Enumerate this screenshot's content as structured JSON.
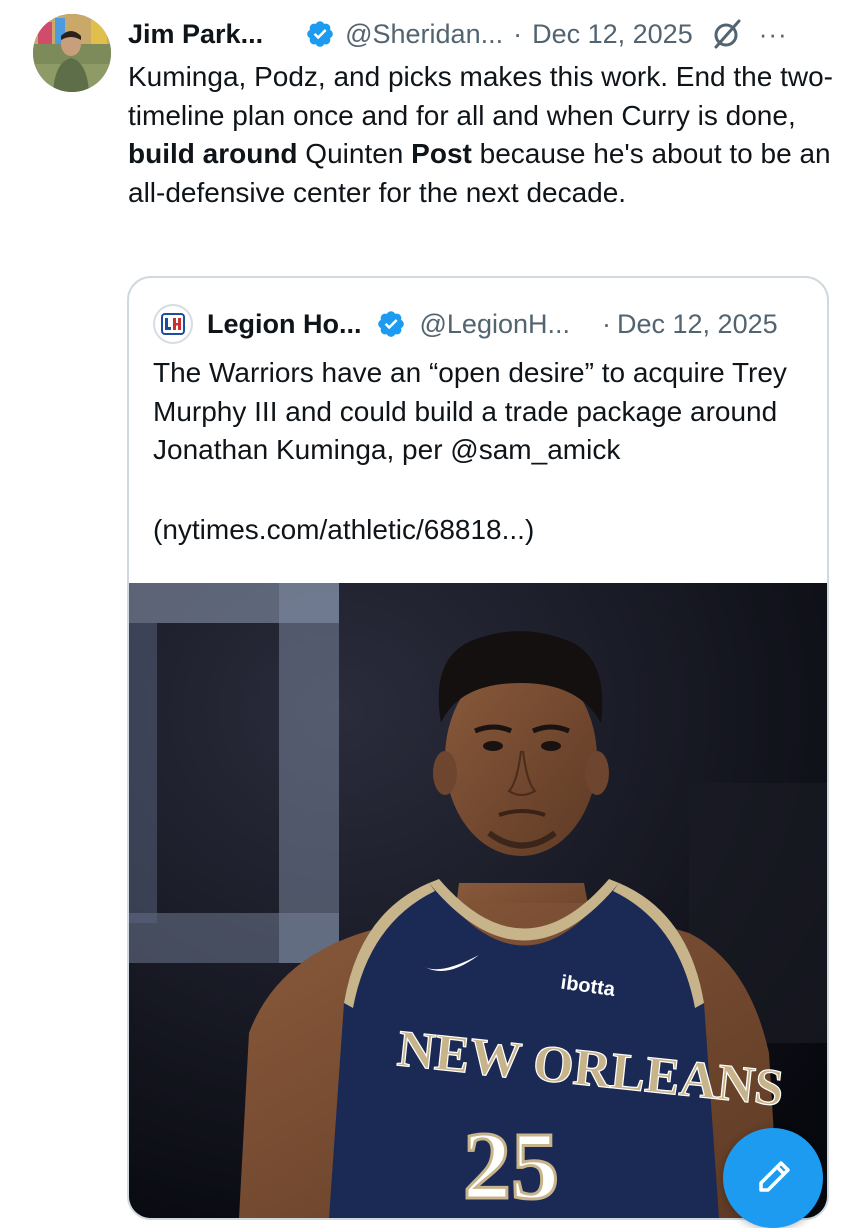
{
  "tweet": {
    "author_name": "Jim Park...",
    "handle": "@Sheridan...",
    "separator": "·",
    "date": "Dec 12, 2025",
    "more_label": "···",
    "text_parts": {
      "p1": "Kuminga, Podz, and picks makes this work. End the two-timeline plan once and for all and when Curry is done, ",
      "b1": "build around",
      "p2": " Quinten ",
      "b2": "Post",
      "p3": " because he's about to be an all-defensive center for the next decade."
    }
  },
  "quoted_tweet": {
    "author_name": "Legion Ho...",
    "handle": "@LegionH...",
    "separator": "·",
    "date": "Dec 12, 2025",
    "text": "The Warriors have an “open desire” to acquire Trey Murphy III and could build a trade package around Jonathan Kuminga, per @sam_amick",
    "link_text": "(nytimes.com/athletic/68818...)",
    "image": {
      "jersey_sponsor": "ibotta",
      "jersey_team": "NEW ORLEANS",
      "jersey_number": "25"
    }
  },
  "colors": {
    "accent": "#1d9bf0",
    "secondary_text": "#536471",
    "border": "#cfd9de",
    "jersey_navy": "#1b2a55",
    "jersey_gold": "#c8b48a"
  },
  "icons": {
    "verified": "verified-badge-icon",
    "grok": "grok-icon",
    "more": "more-icon",
    "compose": "compose-icon"
  }
}
